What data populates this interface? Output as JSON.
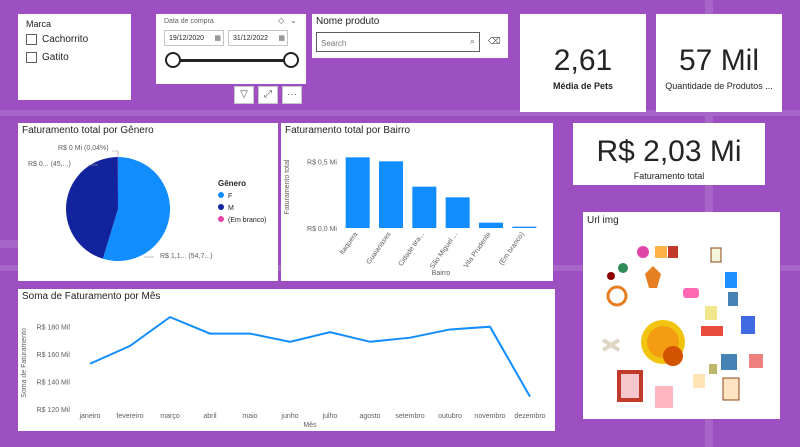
{
  "filters": {
    "marca": {
      "title": "Marca",
      "options": [
        "Cachorrito",
        "Gatito"
      ]
    },
    "data": {
      "title": "Data de compra",
      "start": "19/12/2020",
      "end": "31/12/2022",
      "buttons": [
        "filter-icon",
        "focus-icon",
        "more-icon"
      ],
      "more_label": "···"
    },
    "produto": {
      "title": "Nome produto",
      "placeholder": "Search"
    }
  },
  "kpis": {
    "media_pets": {
      "value": "2,61",
      "label": "Média de Pets"
    },
    "quantidade": {
      "value": "57 Mil",
      "label": "Quantidade de Produtos ..."
    },
    "faturamento": {
      "value": "R$ 2,03 Mi",
      "label": "Faturamento total"
    }
  },
  "genero_chart": {
    "title": "Faturamento total por Gênero",
    "legend_title": "Gênero",
    "labels": {
      "top": "R$ 0 Mi (0,04%)",
      "left": "R$ 0... (45,...)",
      "right": "R$ 1,1... (54,7...)"
    }
  },
  "bairro_chart": {
    "title": "Faturamento total por Bairro",
    "xlabel": "Bairro",
    "ylabel": "Faturamento total",
    "yticks": [
      "R$ 0,5 Mi",
      "R$ 0,0 Mi"
    ]
  },
  "mes_chart": {
    "title": "Soma de Faturamento por Mês",
    "xlabel": "Mês",
    "ylabel": "Soma de Faturamento",
    "yticks": [
      "R$ 180 Mil",
      "R$ 160 Mil",
      "R$ 140 Mil",
      "R$ 120 Mil"
    ]
  },
  "url_img": {
    "title": "Url img"
  },
  "colors": {
    "background": "#9b4fc0",
    "series_blue": "#118dff",
    "series_navy": "#12239e",
    "series_pink": "#e044a7"
  },
  "chart_data": [
    {
      "type": "pie",
      "title": "Faturamento total por Gênero",
      "legend_title": "Gênero",
      "categories": [
        "F",
        "M",
        "(Em branco)"
      ],
      "values": [
        54.7,
        45.26,
        0.04
      ],
      "legend": "right"
    },
    {
      "type": "bar",
      "title": "Faturamento total por Bairro",
      "xlabel": "Bairro",
      "ylabel": "Faturamento total",
      "categories": [
        "Itaquera",
        "Guaianases",
        "Cidade tira...",
        "São Miguel ...",
        "Vila Prudente",
        "(Em branco)"
      ],
      "values": [
        0.53,
        0.5,
        0.31,
        0.23,
        0.04,
        0.01
      ],
      "ylim": [
        0,
        0.6
      ],
      "grid": false
    },
    {
      "type": "line",
      "title": "Soma de Faturamento por Mês",
      "xlabel": "Mês",
      "ylabel": "Soma de Faturamento",
      "categories": [
        "janeiro",
        "fevereiro",
        "março",
        "abril",
        "maio",
        "junho",
        "julho",
        "agosto",
        "setembro",
        "outubro",
        "novembro",
        "dezembro"
      ],
      "values": [
        153,
        166,
        187,
        175,
        175,
        169,
        176,
        169,
        172,
        178,
        180,
        129
      ],
      "ylim": [
        120,
        190
      ],
      "grid": false
    }
  ]
}
